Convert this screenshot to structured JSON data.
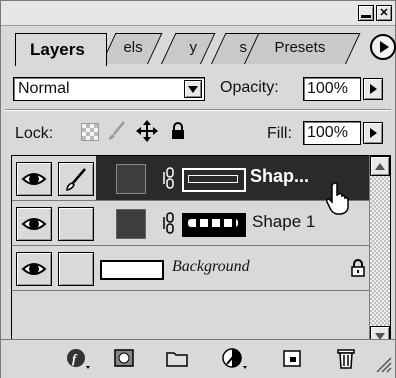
{
  "window": {
    "minimize_glyph": "▬",
    "close_glyph": "✕"
  },
  "tabs": [
    {
      "label": "Layers",
      "active": true
    },
    {
      "label": "els",
      "active": false
    },
    {
      "label": "y",
      "active": false
    },
    {
      "label": "s",
      "active": false
    },
    {
      "label": "Presets",
      "active": false
    }
  ],
  "controls": {
    "blend_mode": "Normal",
    "opacity_label": "Opacity:",
    "opacity_value": "100%",
    "lock_label": "Lock:",
    "fill_label": "Fill:",
    "fill_value": "100%"
  },
  "layers": [
    {
      "name": "Shap...",
      "selected": true,
      "brush": true,
      "has_mask": true
    },
    {
      "name": "Shape 1",
      "selected": false,
      "brush": false,
      "has_mask": true
    },
    {
      "name": "Background",
      "selected": false,
      "brush": false,
      "has_mask": false,
      "locked": true
    }
  ],
  "icons": {
    "menu": "play-triangle-icon",
    "dropdown": "triangle-down-icon",
    "stepper": "triangle-right-icon",
    "eye": "eye-icon",
    "brush": "brush-icon",
    "link": "chain-link-icon",
    "lock": "padlock-icon",
    "cursor": "hand-pointer-icon",
    "footer": [
      "layer-style-icon",
      "add-mask-icon",
      "new-group-icon",
      "adjustment-layer-icon",
      "new-layer-icon",
      "trash-icon"
    ]
  },
  "colors": {
    "panel_bg": "#d9d9d9",
    "selected_row": "#2a2a2a",
    "selected_text": "#ffffff"
  }
}
